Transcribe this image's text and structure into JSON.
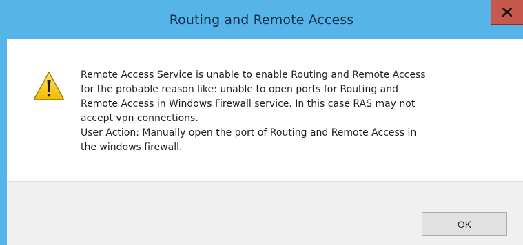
{
  "dialog": {
    "title": "Routing and Remote Access",
    "icon": "warning-icon",
    "message_lines": [
      "Remote Access Service is unable to enable Routing and Remote Access",
      "for the probable reason like:  unable to open ports for Routing and",
      "Remote Access in Windows Firewall service. In this case RAS may not",
      "accept vpn connections.",
      "User Action: Manually open the port of Routing and Remote Access in",
      "the windows firewall."
    ],
    "ok_label": "OK"
  },
  "colors": {
    "frame": "#56b4e9",
    "close_button": "#c6584d",
    "footer": "#f0f0f0",
    "warning_yellow": "#f5c400"
  }
}
